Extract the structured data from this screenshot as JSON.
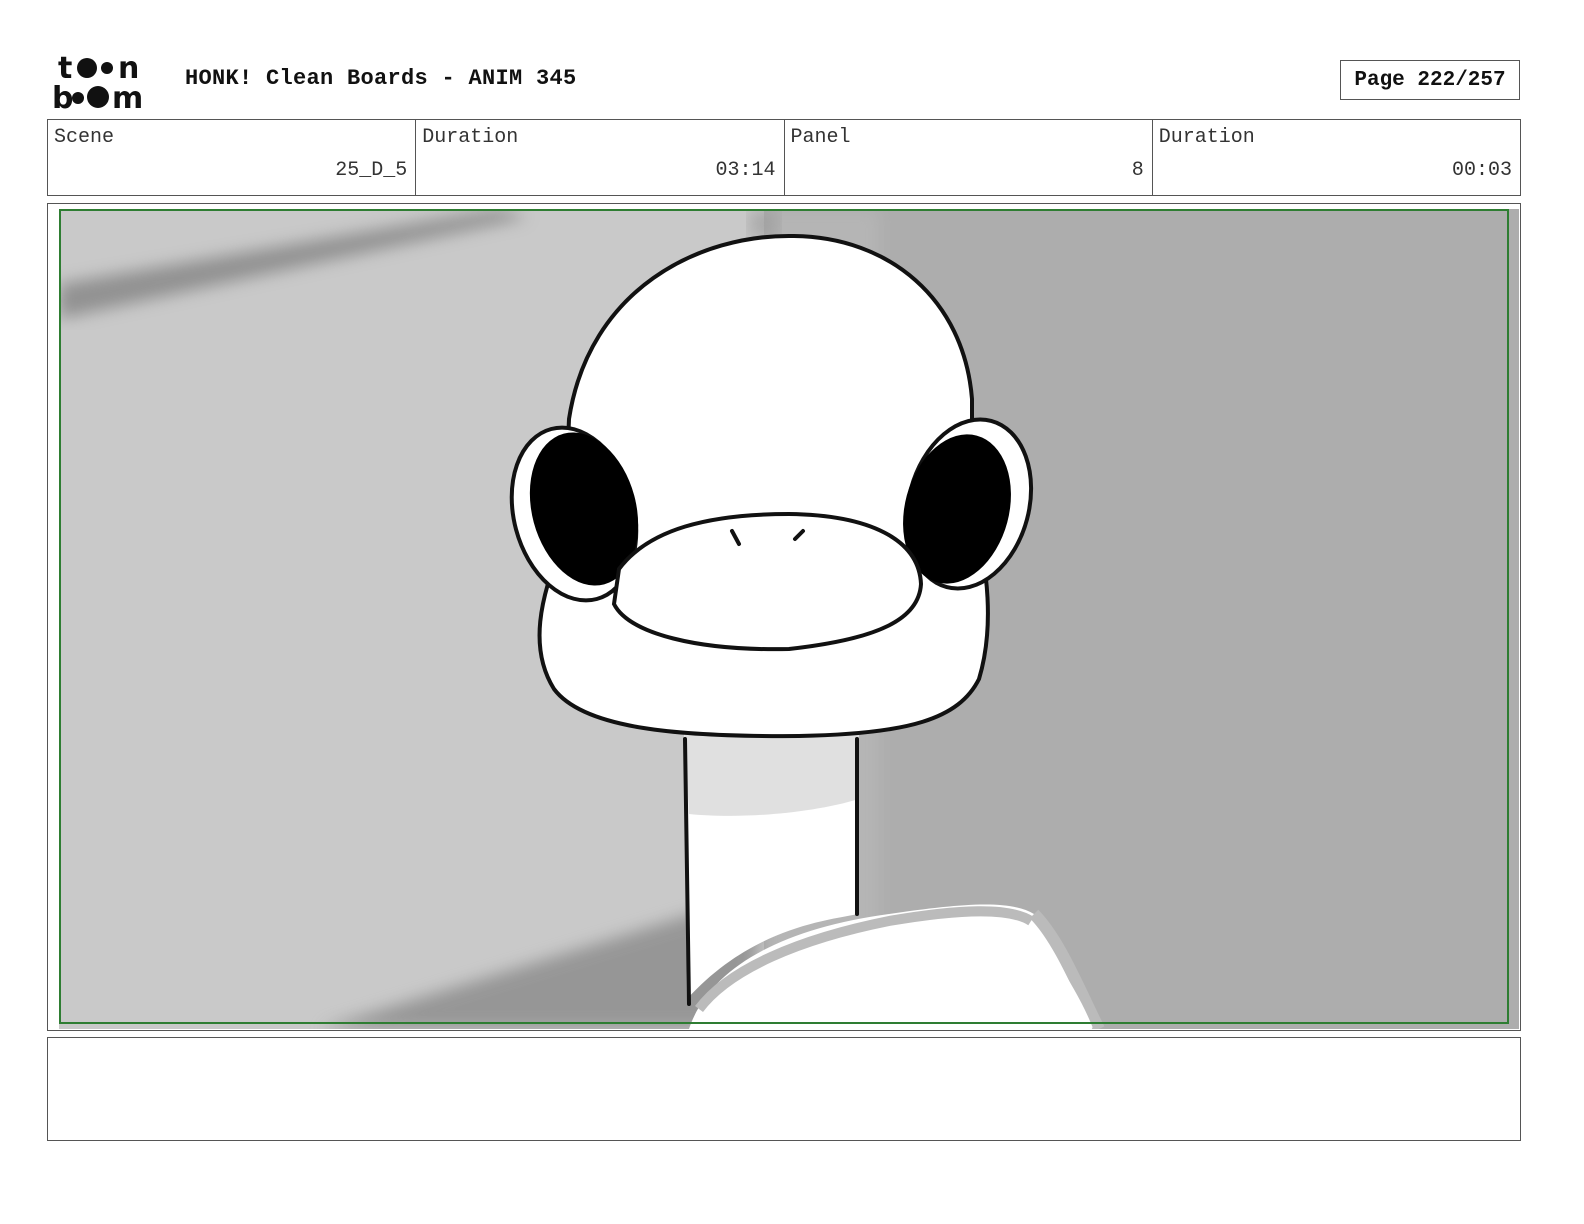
{
  "header": {
    "logo_text": "toon boom",
    "title": "HONK! Clean Boards - ANIM 345",
    "page_label": "Page 222/257"
  },
  "info": [
    {
      "label": "Scene",
      "value": "25_D_5"
    },
    {
      "label": "Duration",
      "value": "03:14"
    },
    {
      "label": "Panel",
      "value": "8"
    },
    {
      "label": "Duration",
      "value": "00:03"
    }
  ],
  "panel": {
    "frame_color": "#2e7d32",
    "description_icon": "goose-head-drawing"
  },
  "notes": {
    "text": ""
  }
}
